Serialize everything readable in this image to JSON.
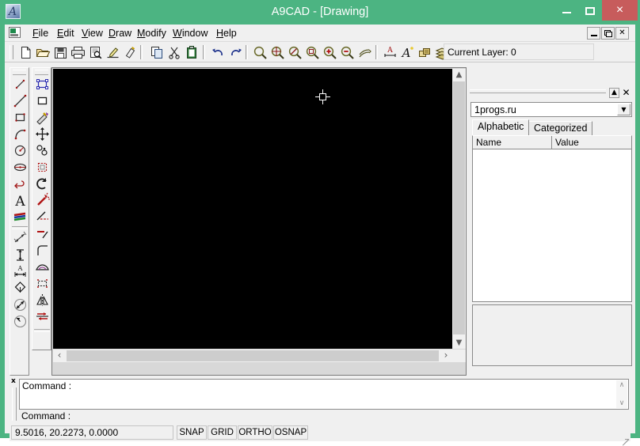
{
  "window": {
    "title": "A9CAD - [Drawing]",
    "app_icon": "app-logo-icon",
    "minimize_label": "",
    "maximize_label": "",
    "close_label": "×",
    "accent_color": "#4cb482",
    "close_button_color": "#c75c5c"
  },
  "menu": {
    "doc_icon": "document-icon",
    "items": [
      {
        "label": "File",
        "accel": "F"
      },
      {
        "label": "Edit",
        "accel": "E"
      },
      {
        "label": "View",
        "accel": "V"
      },
      {
        "label": "Draw",
        "accel": "D"
      },
      {
        "label": "Modify",
        "accel": "M"
      },
      {
        "label": "Window",
        "accel": "W"
      },
      {
        "label": "Help",
        "accel": "H"
      }
    ],
    "mdi_buttons": [
      {
        "name": "mdi-minimize",
        "label": ""
      },
      {
        "name": "mdi-restore",
        "label": ""
      },
      {
        "name": "mdi-close",
        "label": "✕"
      }
    ]
  },
  "toolbar": {
    "buttons": [
      {
        "name": "new-icon",
        "tooltip": "New"
      },
      {
        "name": "open-folder-icon",
        "tooltip": "Open"
      },
      {
        "name": "save-disk-icon",
        "tooltip": "Save"
      },
      {
        "name": "print-icon",
        "tooltip": "Print"
      },
      {
        "name": "print-preview-icon",
        "tooltip": "Print Preview"
      },
      {
        "name": "pen-edit-icon",
        "tooltip": "Edit"
      },
      {
        "name": "format-painter-icon",
        "tooltip": "Format Painter"
      },
      {
        "name": "copy-icon",
        "tooltip": "Copy"
      },
      {
        "name": "cut-scissors-icon",
        "tooltip": "Cut"
      },
      {
        "name": "paste-clipboard-icon",
        "tooltip": "Paste"
      },
      {
        "name": "undo-arrow-icon",
        "tooltip": "Undo"
      },
      {
        "name": "redo-arrow-icon",
        "tooltip": "Redo"
      },
      {
        "name": "zoom-window-icon",
        "tooltip": "Zoom Window"
      },
      {
        "name": "zoom-all-icon",
        "tooltip": "Zoom All"
      },
      {
        "name": "zoom-dynamic-icon",
        "tooltip": "Zoom Dynamic"
      },
      {
        "name": "zoom-extents-icon",
        "tooltip": "Zoom Extents"
      },
      {
        "name": "zoom-in-icon",
        "tooltip": "Zoom In"
      },
      {
        "name": "zoom-out-icon",
        "tooltip": "Zoom Out"
      },
      {
        "name": "pan-hand-icon",
        "tooltip": "Pan"
      },
      {
        "name": "dimension-style-icon",
        "tooltip": "Dimension Style"
      },
      {
        "name": "text-style-icon",
        "tooltip": "Text Style"
      },
      {
        "name": "properties-icon",
        "tooltip": "Properties"
      },
      {
        "name": "layers-icon",
        "tooltip": "Layers"
      }
    ],
    "current_layer_label": "Current Layer: 0"
  },
  "draw_palette": {
    "name": "draw-toolbar",
    "tools": [
      {
        "name": "line-tool",
        "label": "Line"
      },
      {
        "name": "polyline-tool",
        "label": "Polyline"
      },
      {
        "name": "rectangle-tool",
        "label": "Rectangle"
      },
      {
        "name": "arc-tool",
        "label": "Arc"
      },
      {
        "name": "circle-tool",
        "label": "Circle"
      },
      {
        "name": "ellipse-tool",
        "label": "Ellipse"
      },
      {
        "name": "spline-tool",
        "label": "Spline"
      },
      {
        "name": "text-tool",
        "label": "Text"
      },
      {
        "name": "hatch-tool",
        "label": "Hatch"
      },
      {
        "name": "dim-aligned-tool",
        "label": "Aligned Dimension"
      },
      {
        "name": "dim-vertical-tool",
        "label": "Vertical Dimension"
      },
      {
        "name": "dim-linear-tool",
        "label": "Linear Dimension"
      },
      {
        "name": "dim-leader-tool",
        "label": "Leader"
      },
      {
        "name": "dim-diameter-tool",
        "label": "Diameter Dimension"
      },
      {
        "name": "dim-radius-tool",
        "label": "Radius Dimension"
      }
    ]
  },
  "modify_palette": {
    "name": "modify-toolbar",
    "tools": [
      {
        "name": "select-tool",
        "label": "Select"
      },
      {
        "name": "erase-tool",
        "label": "Erase"
      },
      {
        "name": "paint-properties-tool",
        "label": "Match Properties"
      },
      {
        "name": "move-tool",
        "label": "Move"
      },
      {
        "name": "copy-object-tool",
        "label": "Copy"
      },
      {
        "name": "array-tool",
        "label": "Array"
      },
      {
        "name": "rotate-tool",
        "label": "Rotate"
      },
      {
        "name": "explode-tool",
        "label": "Explode"
      },
      {
        "name": "trim-tool",
        "label": "Trim"
      },
      {
        "name": "extend-tool",
        "label": "Extend"
      },
      {
        "name": "fillet-tool",
        "label": "Fillet"
      },
      {
        "name": "chamfer-tool",
        "label": "Chamfer"
      },
      {
        "name": "offset-tool",
        "label": "Offset"
      },
      {
        "name": "mirror-tool",
        "label": "Mirror"
      },
      {
        "name": "stretch-tool",
        "label": "Stretch"
      }
    ]
  },
  "drawing": {
    "canvas_background": "#000000",
    "cursor": "crosshair-cursor",
    "vertical_scrollbar": {
      "up_arrow": "▲",
      "down_arrow": "▼"
    },
    "horizontal_scrollbar": {
      "left_arrow": "‹",
      "right_arrow": "›"
    }
  },
  "properties_panel": {
    "pin_label": "▲",
    "close_label": "✕",
    "combo_value": "1progs.ru",
    "combo_arrow": "▼",
    "tabs": [
      {
        "name": "tab-alphabetic",
        "label": "Alphabetic",
        "active": true
      },
      {
        "name": "tab-categorized",
        "label": "Categorized",
        "active": false
      }
    ],
    "grid_columns": [
      "Name",
      "Value"
    ],
    "grid_rows": []
  },
  "command_window": {
    "close_label": "x",
    "history_lines": [
      "Command :"
    ],
    "prompt": "Command :",
    "scroll_up": "∧",
    "scroll_down": "∨"
  },
  "status_bar": {
    "coordinates": "9.5016, 20.2273, 0.0000",
    "toggles": [
      {
        "name": "snap-toggle",
        "label": "SNAP"
      },
      {
        "name": "grid-toggle",
        "label": "GRID"
      },
      {
        "name": "ortho-toggle",
        "label": "ORTHO"
      },
      {
        "name": "osnap-toggle",
        "label": "OSNAP"
      }
    ]
  }
}
